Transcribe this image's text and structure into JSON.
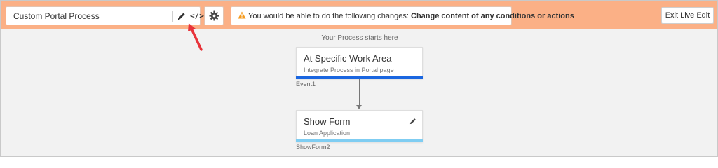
{
  "header": {
    "process_title": "Custom Portal Process",
    "edit_icon": "pencil-icon",
    "code_icon": "code-icon",
    "code_glyph": "</>",
    "settings_icon": "gear-icon",
    "info": {
      "icon": "warning-icon",
      "prefix": "You would be able to do the following changes: ",
      "emphasis": "Change content of any conditions or actions"
    },
    "exit_button": "Exit Live Edit"
  },
  "canvas": {
    "start_label": "Your Process starts here",
    "nodes": [
      {
        "title": "At Specific Work Area",
        "subtitle": "Integrate Process in Portal page",
        "id_label": "Event1",
        "bar_color": "#1a66e0"
      },
      {
        "title": "Show Form",
        "subtitle": "Loan Application",
        "id_label": "ShowForm2",
        "bar_color": "#7fcdf2",
        "edit_icon": "pencil-icon"
      }
    ]
  },
  "colors": {
    "header_bg": "#fbb086",
    "canvas_bg": "#f2f2f2",
    "warning": "#f59a1c",
    "annotation_arrow": "#e8333a"
  }
}
